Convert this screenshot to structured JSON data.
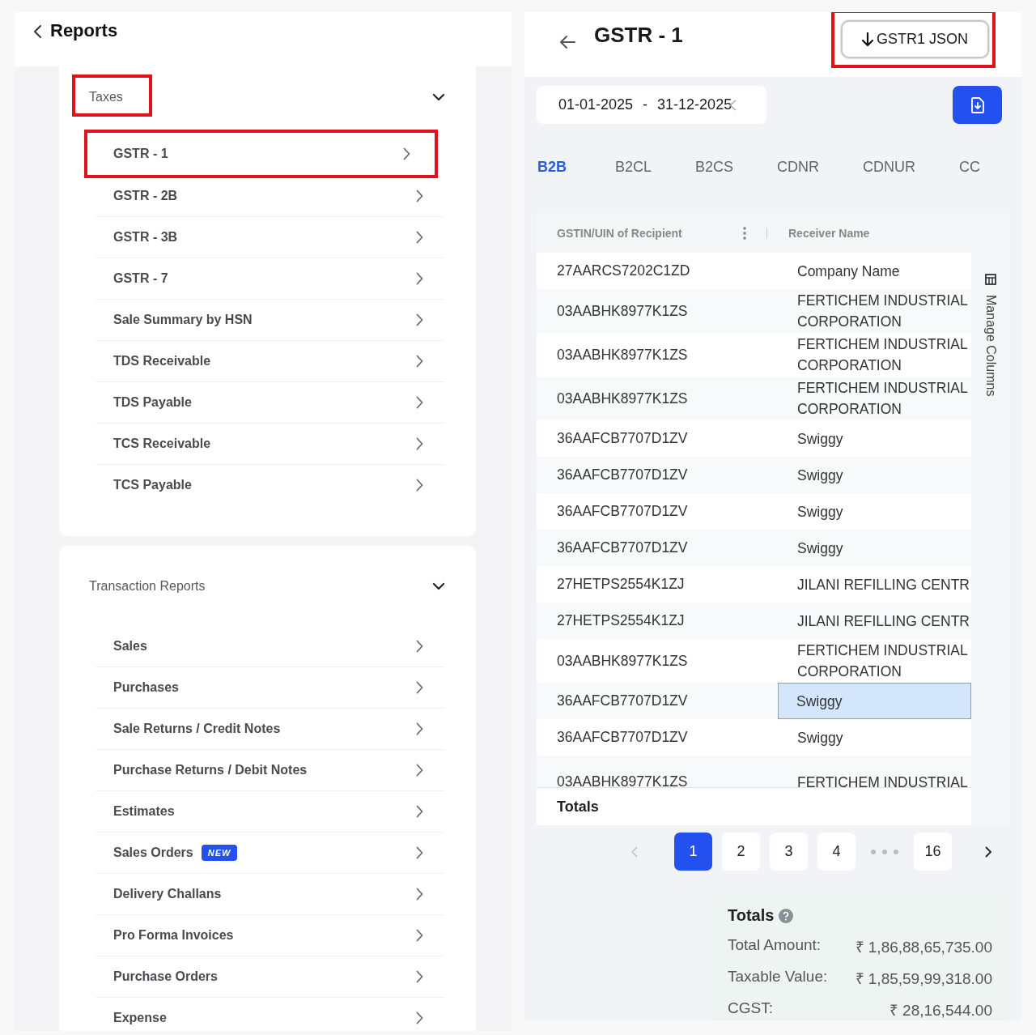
{
  "reports": {
    "title": "Reports",
    "sections": [
      {
        "title": "Taxes",
        "expanded": true,
        "highlighted": true,
        "items": [
          {
            "label": "GSTR - 1",
            "highlighted": true
          },
          {
            "label": "GSTR - 2B",
            "highlighted": false
          },
          {
            "label": "GSTR - 3B",
            "highlighted": false
          },
          {
            "label": "GSTR - 7",
            "highlighted": false
          },
          {
            "label": "Sale Summary by HSN",
            "highlighted": false
          },
          {
            "label": "TDS Receivable",
            "highlighted": false
          },
          {
            "label": "TDS Payable",
            "highlighted": false
          },
          {
            "label": "TCS Receivable",
            "highlighted": false
          },
          {
            "label": "TCS Payable",
            "highlighted": false
          }
        ]
      },
      {
        "title": "Transaction Reports",
        "expanded": true,
        "highlighted": false,
        "items": [
          {
            "label": "Sales",
            "highlighted": false
          },
          {
            "label": "Purchases",
            "highlighted": false
          },
          {
            "label": "Sale Returns / Credit Notes",
            "highlighted": false
          },
          {
            "label": "Purchase Returns / Debit Notes",
            "highlighted": false
          },
          {
            "label": "Estimates",
            "highlighted": false
          },
          {
            "label": "Sales Orders",
            "badge": "NEW",
            "highlighted": false
          },
          {
            "label": "Delivery Challans",
            "highlighted": false
          },
          {
            "label": "Pro Forma Invoices",
            "highlighted": false
          },
          {
            "label": "Purchase Orders",
            "highlighted": false
          },
          {
            "label": "Expense",
            "highlighted": false
          }
        ]
      }
    ]
  },
  "gstr": {
    "title": "GSTR - 1",
    "json_button": {
      "label": "GSTR1 JSON",
      "highlighted": true
    },
    "date_range": {
      "from": "01-01-2025",
      "separator": "-",
      "to": "31-12-2025"
    },
    "tabs": [
      {
        "label": "B2B",
        "selected": true
      },
      {
        "label": "B2CL",
        "selected": false
      },
      {
        "label": "B2CS",
        "selected": false
      },
      {
        "label": "CDNR",
        "selected": false
      },
      {
        "label": "CDNUR",
        "selected": false
      },
      {
        "label": "CC",
        "selected": false
      }
    ],
    "table": {
      "columns": [
        "GSTIN/UIN of Recipient",
        "Receiver Name"
      ],
      "rows": [
        {
          "gstin": "27AARCS7202C1ZD",
          "receiver": "Company Name",
          "selected": false
        },
        {
          "gstin": "03AABHK8977K1ZS",
          "receiver": "FERTICHEM INDUSTRIAL CORPORATION",
          "selected": false
        },
        {
          "gstin": "03AABHK8977K1ZS",
          "receiver": "FERTICHEM INDUSTRIAL CORPORATION",
          "selected": false
        },
        {
          "gstin": "03AABHK8977K1ZS",
          "receiver": "FERTICHEM INDUSTRIAL CORPORATION",
          "selected": false
        },
        {
          "gstin": "36AAFCB7707D1ZV",
          "receiver": "Swiggy",
          "selected": false
        },
        {
          "gstin": "36AAFCB7707D1ZV",
          "receiver": "Swiggy",
          "selected": false
        },
        {
          "gstin": "36AAFCB7707D1ZV",
          "receiver": "Swiggy",
          "selected": false
        },
        {
          "gstin": "36AAFCB7707D1ZV",
          "receiver": "Swiggy",
          "selected": false
        },
        {
          "gstin": "27HETPS2554K1ZJ",
          "receiver": "JILANI REFILLING CENTR",
          "selected": false
        },
        {
          "gstin": "27HETPS2554K1ZJ",
          "receiver": "JILANI REFILLING CENTR",
          "selected": false
        },
        {
          "gstin": "03AABHK8977K1ZS",
          "receiver": "FERTICHEM INDUSTRIAL CORPORATION",
          "selected": false
        },
        {
          "gstin": "36AAFCB7707D1ZV",
          "receiver": "Swiggy",
          "selected": true
        },
        {
          "gstin": "36AAFCB7707D1ZV",
          "receiver": "Swiggy",
          "selected": false
        },
        {
          "gstin": "03AABHK8977K1ZS",
          "receiver": "FERTICHEM INDUSTRIAL",
          "selected": false
        }
      ],
      "totals_label": "Totals",
      "manage_columns": "Manage Columns"
    },
    "pagination": {
      "prev_disabled": true,
      "pages": [
        {
          "kind": "page",
          "label": "1",
          "selected": true
        },
        {
          "kind": "page",
          "label": "2",
          "selected": false
        },
        {
          "kind": "page",
          "label": "3",
          "selected": false
        },
        {
          "kind": "page",
          "label": "4",
          "selected": false
        },
        {
          "kind": "ellipsis",
          "selected": false
        },
        {
          "kind": "page",
          "label": "16",
          "selected": false
        }
      ]
    },
    "totals": {
      "title": "Totals",
      "lines": [
        {
          "label": "Total Amount:",
          "value": "₹ 1,86,88,65,735.00"
        },
        {
          "label": "Taxable Value:",
          "value": "₹ 1,85,59,99,318.00"
        },
        {
          "label": "CGST:",
          "value": "₹ 28,16,544.00"
        }
      ]
    }
  }
}
